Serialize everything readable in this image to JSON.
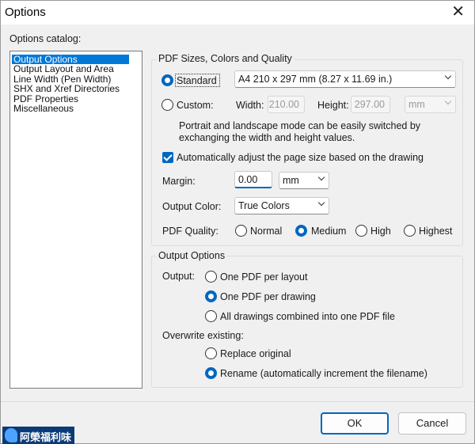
{
  "window": {
    "title": "Options",
    "close_glyph": "✕"
  },
  "catalog": {
    "label": "Options catalog:",
    "items": [
      {
        "label": "Output Options",
        "selected": true
      },
      {
        "label": "Output Layout and Area",
        "selected": false
      },
      {
        "label": "Line Width (Pen Width)",
        "selected": false
      },
      {
        "label": "SHX and Xref Directories",
        "selected": false
      },
      {
        "label": "PDF Properties",
        "selected": false
      },
      {
        "label": "Miscellaneous",
        "selected": false
      }
    ]
  },
  "pdf_group": {
    "title": "PDF Sizes, Colors and Quality",
    "standard": {
      "label": "Standard",
      "selected": true,
      "value": "A4 210 x 297 mm (8.27 x 11.69 in.)"
    },
    "custom": {
      "label": "Custom:",
      "selected": false,
      "width_label": "Width:",
      "width_value": "210.00",
      "height_label": "Height:",
      "height_value": "297.00",
      "unit_value": "mm"
    },
    "hint_line1": "Portrait and landscape mode can be easily switched by",
    "hint_line2": "exchanging the width and height values.",
    "auto_adjust": {
      "label": "Automatically adjust the page size based on the drawing",
      "checked": true
    },
    "margin": {
      "label": "Margin:",
      "value": "0.00",
      "unit": "mm"
    },
    "output_color": {
      "label": "Output Color:",
      "value": "True Colors"
    },
    "quality": {
      "label": "PDF Quality:",
      "options": [
        "Normal",
        "Medium",
        "High",
        "Highest"
      ],
      "selected": "Medium"
    }
  },
  "output_group": {
    "title": "Output Options",
    "output_label": "Output:",
    "output_options": [
      "One PDF per layout",
      "One PDF per drawing",
      "All drawings combined into one PDF file"
    ],
    "output_selected": "One PDF per drawing",
    "overwrite_label": "Overwrite existing:",
    "overwrite_options": [
      "Replace original",
      "Rename (automatically increment the filename)"
    ],
    "overwrite_selected": "Rename (automatically increment the filename)"
  },
  "buttons": {
    "ok": "OK",
    "cancel": "Cancel"
  },
  "watermark": {
    "text": "阿榮福利味"
  },
  "colors": {
    "accent": "#0067c0",
    "selection": "#0078d7",
    "dialog_bg": "#f0f0f0"
  }
}
